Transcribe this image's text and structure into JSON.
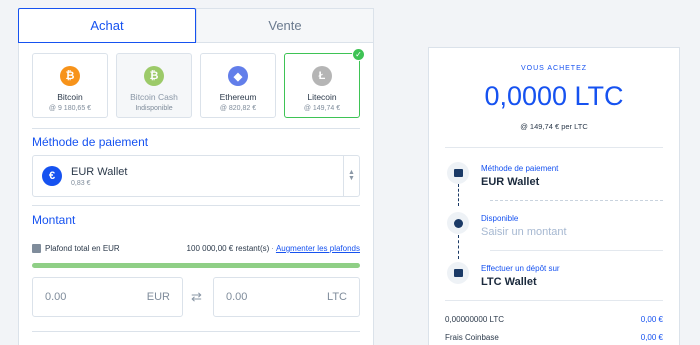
{
  "tabs": {
    "buy": "Achat",
    "sell": "Vente"
  },
  "coins": [
    {
      "name": "Bitcoin",
      "price": "@ 9 180,65 €",
      "icon": "bitcoin-icon",
      "color": "#f7931a",
      "glyph": "₿"
    },
    {
      "name": "Bitcoin Cash",
      "price": "Indisponible",
      "icon": "bitcoin-cash-icon",
      "color": "#8dc351",
      "glyph": "₿"
    },
    {
      "name": "Ethereum",
      "price": "@ 820,82 €",
      "icon": "ethereum-icon",
      "color": "#627eea",
      "glyph": "◆"
    },
    {
      "name": "Litecoin",
      "price": "@ 149,74 €",
      "icon": "litecoin-icon",
      "color": "#b5b5b5",
      "glyph": "Ł"
    }
  ],
  "payment": {
    "title": "Méthode de paiement",
    "wallet_name": "EUR Wallet",
    "wallet_balance": "0,83 €",
    "icon_glyph": "€"
  },
  "amount": {
    "title": "Montant",
    "limit_label": "Plafond total en EUR",
    "limit_amount": "100 000,00 € restant(s)",
    "limit_sep": "·",
    "limit_link": "Augmenter les plafonds",
    "limit_fraction": 1.0,
    "eur_value": "0.00",
    "eur_unit": "EUR",
    "ltc_value": "0.00",
    "ltc_unit": "LTC",
    "swap_glyph": "⇄"
  },
  "summary": {
    "buy_label": "VOUS ACHETEZ",
    "buy_amount": "0,0000 LTC",
    "rate": "@ 149,74 € per LTC",
    "steps": [
      {
        "label": "Méthode de paiement",
        "value": "EUR Wallet"
      },
      {
        "label": "Disponible",
        "value": "Saisir un montant"
      },
      {
        "label": "Effectuer un dépôt sur",
        "value": "LTC Wallet"
      }
    ],
    "fees": [
      {
        "label": "0,00000000 LTC",
        "value": "0,00 €"
      },
      {
        "label": "Frais Coinbase",
        "value": "0,00 €"
      }
    ]
  },
  "colors": {
    "accent": "#1652f0",
    "success": "#3ec355"
  }
}
